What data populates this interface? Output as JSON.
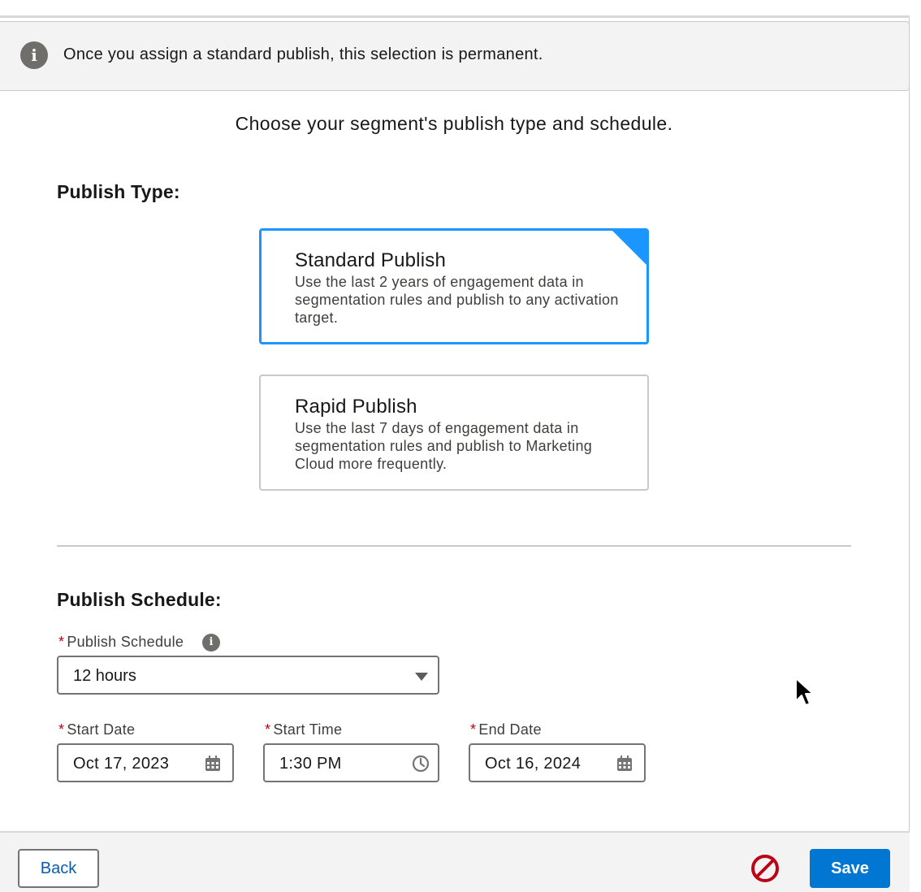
{
  "banner": {
    "text": "Once you assign a standard publish, this selection is permanent.",
    "icon": "info-icon"
  },
  "subtitle": "Choose your segment's publish type and schedule.",
  "publish_type": {
    "heading": "Publish Type:",
    "options": [
      {
        "title": "Standard Publish",
        "description": "Use the last 2 years of engagement data in segmentation rules and publish to any activation target.",
        "selected": true
      },
      {
        "title": "Rapid Publish",
        "description": "Use the last 7 days of engagement data in segmentation rules and publish to Marketing Cloud more frequently.",
        "selected": false
      }
    ]
  },
  "publish_schedule": {
    "heading": "Publish Schedule:",
    "schedule_label": "Publish Schedule",
    "schedule_value": "12 hours",
    "required_marker": "*",
    "start_date_label": "Start Date",
    "start_date_value": "Oct 17, 2023",
    "start_time_label": "Start Time",
    "start_time_value": "1:30 PM",
    "end_date_label": "End Date",
    "end_date_value": "Oct 16, 2024"
  },
  "footer": {
    "back_label": "Back",
    "save_label": "Save"
  },
  "colors": {
    "brand": "#0176d3",
    "selected_border": "#1b96ff",
    "required": "#ba0517",
    "disabled_icon": "#ba0517"
  }
}
